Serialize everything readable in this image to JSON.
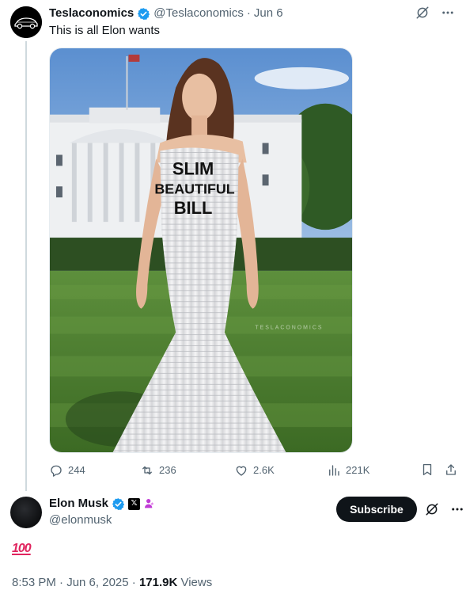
{
  "parent_tweet": {
    "display_name": "Teslaconomics",
    "handle": "@Teslaconomics",
    "separator": "·",
    "date": "Jun 6",
    "text": "This is all Elon wants",
    "image": {
      "dress_text": [
        "SLIM",
        "BEAUTIFUL",
        "BILL"
      ],
      "watermark": "TESLACONOMICS"
    },
    "actions": {
      "replies": "244",
      "reposts": "236",
      "likes": "2.6K",
      "views": "221K"
    }
  },
  "reply_tweet": {
    "display_name": "Elon Musk",
    "handle": "@elonmusk",
    "subscribe_label": "Subscribe",
    "text": "100",
    "timestamp": "8:53 PM · Jun 6, 2025",
    "separator": " · ",
    "views_count": "171.9K",
    "views_label": "Views"
  },
  "colors": {
    "text_primary": "#0f1419",
    "text_secondary": "#536471",
    "verified_blue": "#1d9bf0",
    "accent_red": "#e0245e",
    "thread_line": "#cfd9de"
  },
  "icons": [
    "tesla-car-icon",
    "verified-badge-icon",
    "grok-icon",
    "more-icon",
    "reply-icon",
    "repost-icon",
    "like-icon",
    "views-icon",
    "bookmark-icon",
    "share-icon",
    "x-badge-icon",
    "person-badge-icon",
    "hundred-points-icon"
  ]
}
